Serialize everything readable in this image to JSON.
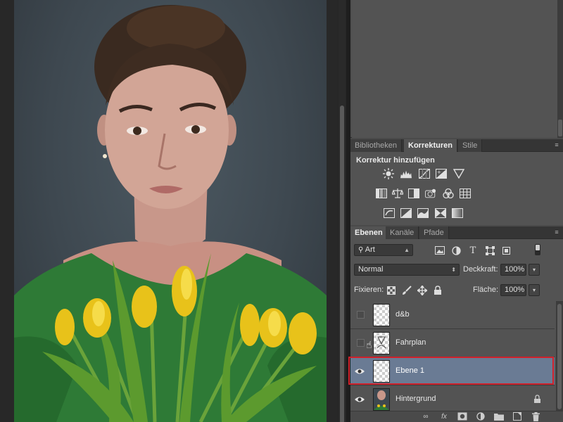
{
  "panels": {
    "corrections": {
      "tabs": [
        "Bibliotheken",
        "Korrekturen",
        "Stile"
      ],
      "active_tab": "Korrekturen",
      "title": "Korrektur hinzufügen",
      "icons_row1": [
        "brightness-icon",
        "levels-icon",
        "curves-icon",
        "exposure-icon",
        "vibrance-icon"
      ],
      "icons_row2": [
        "hue-saturation-icon",
        "color-balance-icon",
        "black-white-icon",
        "photo-filter-icon",
        "channel-mixer-icon",
        "color-lookup-icon"
      ],
      "icons_row3": [
        "invert-icon",
        "posterize-icon",
        "threshold-icon",
        "selective-color-icon",
        "gradient-map-icon"
      ]
    },
    "layers": {
      "tabs": [
        "Ebenen",
        "Kanäle",
        "Pfade"
      ],
      "active_tab": "Ebenen",
      "filter_label": "Art",
      "blend_mode": "Normal",
      "opacity_label": "Deckkraft:",
      "opacity_value": "100%",
      "lock_label": "Fixieren:",
      "fill_label": "Fläche:",
      "fill_value": "100%",
      "items": [
        {
          "name": "d&b",
          "visible": false,
          "selected": false
        },
        {
          "name": "Fahrplan",
          "visible": false,
          "selected": false
        },
        {
          "name": "Ebene 1",
          "visible": true,
          "selected": true
        },
        {
          "name": "Hintergrund",
          "visible": true,
          "selected": false,
          "locked": true
        }
      ],
      "bottom_icons": [
        "link-icon",
        "fx-icon",
        "mask-icon",
        "adjustment-icon",
        "folder-icon",
        "new-layer-icon",
        "trash-icon"
      ],
      "fx_label": "fx"
    }
  },
  "colors": {
    "selection_outline": "#d0202a",
    "selected_row": "#6a7b94",
    "panel_bg": "#535353"
  }
}
